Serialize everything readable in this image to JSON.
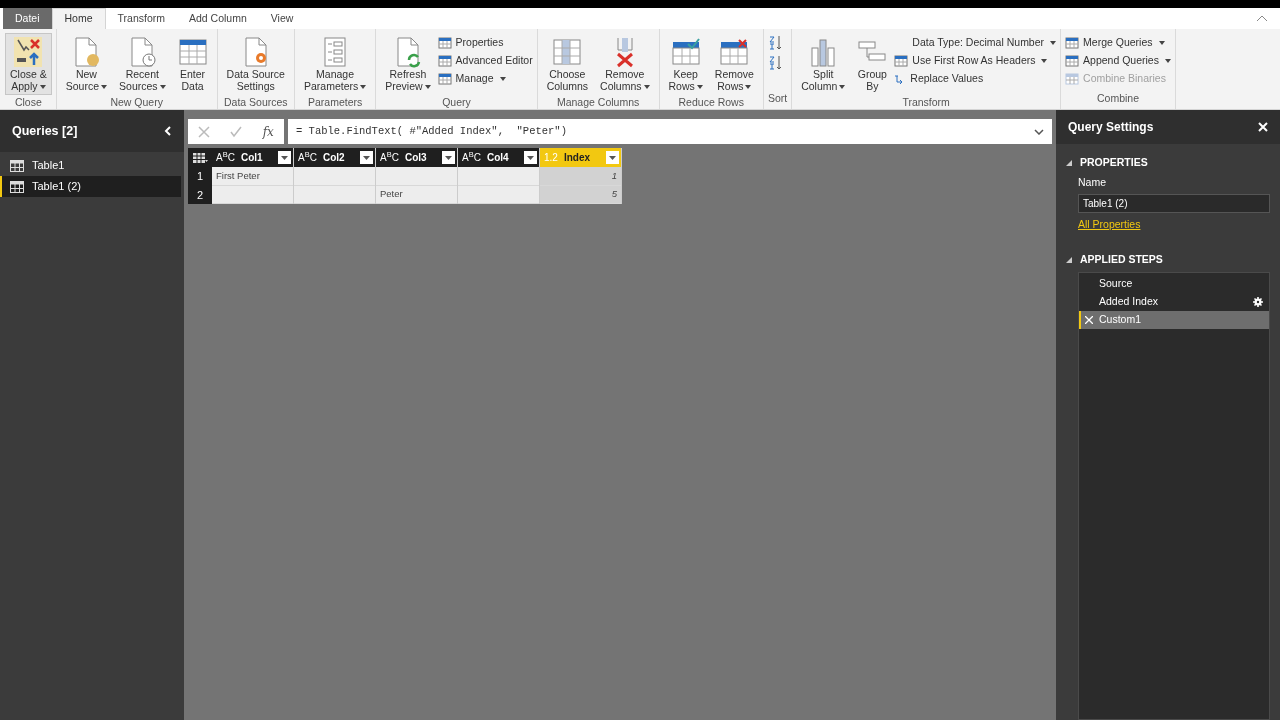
{
  "menu_tabs": [
    {
      "label": "Datei",
      "kind": "file",
      "selected": false
    },
    {
      "label": "Home",
      "kind": "tab",
      "selected": true
    },
    {
      "label": "Transform",
      "kind": "tab",
      "selected": false
    },
    {
      "label": "Add Column",
      "kind": "tab",
      "selected": false
    },
    {
      "label": "View",
      "kind": "tab",
      "selected": false
    }
  ],
  "ribbon_groups": [
    {
      "title": "Close",
      "items": [
        {
          "kind": "large",
          "lines": [
            "Close &",
            "Apply"
          ],
          "dropdown": true,
          "selected": true
        }
      ]
    },
    {
      "title": "New Query",
      "items": [
        {
          "kind": "large",
          "lines": [
            "New",
            "Source"
          ],
          "dropdown": true,
          "selected": false
        },
        {
          "kind": "large",
          "lines": [
            "Recent",
            "Sources"
          ],
          "dropdown": true,
          "selected": false
        },
        {
          "kind": "large",
          "lines": [
            "Enter",
            "Data"
          ],
          "dropdown": false,
          "selected": false
        }
      ]
    },
    {
      "title": "Data Sources",
      "items": [
        {
          "kind": "large",
          "lines": [
            "Data Source",
            "Settings"
          ],
          "dropdown": false,
          "selected": false
        }
      ]
    },
    {
      "title": "Parameters",
      "items": [
        {
          "kind": "large",
          "lines": [
            "Manage",
            "Parameters"
          ],
          "dropdown": true,
          "selected": false
        }
      ]
    },
    {
      "title": "Query",
      "items": [
        {
          "kind": "large",
          "lines": [
            "Refresh",
            "Preview"
          ],
          "dropdown": true,
          "selected": false
        },
        {
          "kind": "stack",
          "items": [
            {
              "label": "Properties",
              "dropdown": false,
              "disabled": false
            },
            {
              "label": "Advanced Editor",
              "dropdown": false,
              "disabled": false
            },
            {
              "label": "Manage",
              "dropdown": true,
              "disabled": false
            }
          ]
        }
      ]
    },
    {
      "title": "Manage Columns",
      "items": [
        {
          "kind": "large",
          "lines": [
            "Choose",
            "Columns"
          ],
          "dropdown": false,
          "selected": false
        },
        {
          "kind": "large",
          "lines": [
            "Remove",
            "Columns"
          ],
          "dropdown": true,
          "selected": false
        }
      ]
    },
    {
      "title": "Reduce Rows",
      "items": [
        {
          "kind": "large",
          "lines": [
            "Keep",
            "Rows"
          ],
          "dropdown": true,
          "selected": false
        },
        {
          "kind": "large",
          "lines": [
            "Remove",
            "Rows"
          ],
          "dropdown": true,
          "selected": false
        }
      ]
    },
    {
      "title": "Sort",
      "items": [
        {
          "kind": "sort"
        }
      ]
    },
    {
      "title": "Transform",
      "items": [
        {
          "kind": "large",
          "lines": [
            "Split",
            "Column"
          ],
          "dropdown": true,
          "selected": false
        },
        {
          "kind": "large",
          "lines": [
            "Group",
            "By"
          ],
          "dropdown": false,
          "selected": false
        },
        {
          "kind": "stack",
          "items": [
            {
              "label": "Data Type: Decimal Number",
              "dropdown": true,
              "disabled": false
            },
            {
              "label": "Use First Row As Headers",
              "dropdown": true,
              "disabled": false
            },
            {
              "label": "Replace Values",
              "dropdown": false,
              "disabled": false
            }
          ]
        }
      ]
    },
    {
      "title": "Combine",
      "items": [
        {
          "kind": "stack",
          "items": [
            {
              "label": "Merge Queries",
              "dropdown": true,
              "disabled": false
            },
            {
              "label": "Append Queries",
              "dropdown": true,
              "disabled": false
            },
            {
              "label": "Combine Binaries",
              "dropdown": false,
              "disabled": true
            }
          ]
        }
      ]
    }
  ],
  "queries": {
    "title": "Queries [2]",
    "items": [
      {
        "label": "Table1",
        "selected": false
      },
      {
        "label": "Table1 (2)",
        "selected": true
      }
    ]
  },
  "formula": {
    "fx": "fx",
    "value": "= Table.FindText( #\"Added Index\",  \"Peter\")"
  },
  "table": {
    "columns": [
      {
        "type": "A$^{B}$C",
        "name": "Col1",
        "selected": false
      },
      {
        "type": "A$^{B}$C",
        "name": "Col2",
        "selected": false
      },
      {
        "type": "A$^{B}$C",
        "name": "Col3",
        "selected": false
      },
      {
        "type": "A$^{B}$C",
        "name": "Col4",
        "selected": false
      },
      {
        "type": "1.2",
        "name": "Index",
        "selected": true
      }
    ],
    "rows": [
      {
        "number": "1",
        "cells": [
          "First Peter",
          "",
          "",
          "",
          "1"
        ]
      },
      {
        "number": "2",
        "cells": [
          "",
          "",
          "Peter",
          "",
          "5"
        ]
      }
    ]
  },
  "settings": {
    "title": "Query Settings",
    "properties_heading": "PROPERTIES",
    "name_label": "Name",
    "name_value": "Table1 (2)",
    "all_properties": "All Properties",
    "steps_heading": "APPLIED STEPS",
    "steps": [
      {
        "label": "Source",
        "selected": false,
        "has_settings": false
      },
      {
        "label": "Added Index",
        "selected": false,
        "has_settings": true
      },
      {
        "label": "Custom1",
        "selected": true,
        "has_settings": false
      }
    ]
  }
}
